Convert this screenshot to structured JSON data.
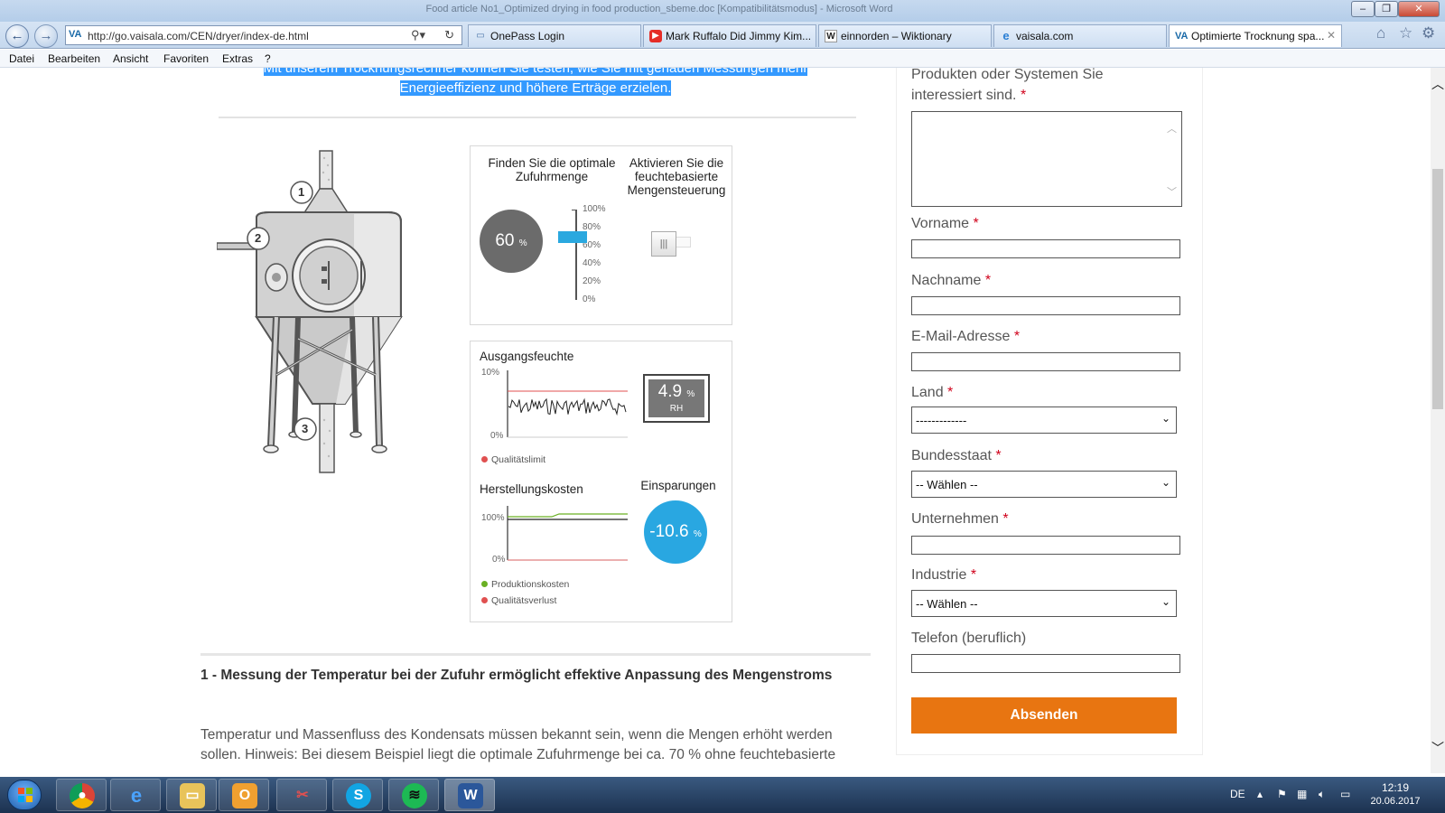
{
  "window": {
    "title": "Food article No1_Optimized drying in food production_sbeme.doc [Kompatibilitätsmodus] - Microsoft Word"
  },
  "browser": {
    "url": "http://go.vaisala.com/CEN/dryer/index-de.html",
    "tabs": [
      {
        "label": "OnePass Login",
        "icon": "onepass-icon"
      },
      {
        "label": "Mark Ruffalo Did Jimmy Kim...",
        "icon": "youtube-icon"
      },
      {
        "label": "einnorden – Wiktionary",
        "icon": "wiktionary-icon"
      },
      {
        "label": "vaisala.com",
        "icon": "ie-icon"
      },
      {
        "label": "Optimierte Trocknung spa...",
        "icon": "vaisala-icon"
      }
    ],
    "menu": [
      "Datei",
      "Bearbeiten",
      "Ansicht",
      "Favoriten",
      "Extras",
      "?"
    ]
  },
  "page": {
    "intro_line1": "Mit unserem Trocknungsrechner können Sie testen, wie Sie mit genauen Messungen mehr",
    "intro_line2": "Energieeffizienz und höhere Erträge erzielen.",
    "diagram_labels": [
      "1",
      "2",
      "3"
    ],
    "panel1": {
      "feed_title": "Finden Sie die optimale Zufuhrmenge",
      "feed_value": "60",
      "feed_unit": "%",
      "feed_slider_level_pct": 70,
      "toggle_title": "Aktivieren Sie die feuchtebasierte Mengensteuerung",
      "toggle_symbol": "|||",
      "slider_ticks": [
        "100%",
        "80%",
        "60%",
        "40%",
        "20%",
        "0%"
      ]
    },
    "panel2": {
      "humidity_title": "Ausgangsfeuchte",
      "humidity_ticks": [
        "10%",
        "0%"
      ],
      "rh_value": "4.9",
      "rh_unit": "%",
      "rh_label": "RH",
      "legend_quality_limit": "Qualitätslimit",
      "cost_title": "Herstellungskosten",
      "cost_ticks": [
        "100%",
        "0%"
      ],
      "savings_title": "Einsparungen",
      "savings_value": "-10.6",
      "savings_unit": "%",
      "legend_production_cost": "Produktionskosten",
      "legend_quality_loss": "Qualitätsverlust"
    },
    "section_heading": "1 - Messung der Temperatur bei der Zufuhr ermöglicht effektive Anpassung des Mengenstroms",
    "section_body": "Temperatur und Massenfluss des Kondensats müssen bekannt sein, wenn die Mengen erhöht werden sollen. Hinweis: Bei diesem Beispiel liegt die optimale Zufuhrmenge bei ca. 70 % ohne feuchtebasierte"
  },
  "form": {
    "interest_label": "Produkten oder Systemen Sie interessiert sind.",
    "required_marker": "*",
    "first_name_label": "Vorname",
    "last_name_label": "Nachname",
    "email_label": "E-Mail-Adresse",
    "country_label": "Land",
    "country_value": "-------------",
    "state_label": "Bundesstaat",
    "state_value": "-- Wählen --",
    "company_label": "Unternehmen",
    "industry_label": "Industrie",
    "industry_value": "-- Wählen --",
    "phone_label": "Telefon (beruflich)",
    "submit_label": "Absenden"
  },
  "taskbar": {
    "apps": [
      "chrome-icon",
      "internet-explorer-icon",
      "explorer-icon",
      "outlook-icon",
      "snipping-tool-icon",
      "skype-icon",
      "spotify-icon",
      "word-icon"
    ],
    "language": "DE",
    "time": "12:19",
    "date": "20.06.2017"
  },
  "colors": {
    "highlight": "#3399ff",
    "slider_blue": "#2aa8df",
    "savings_blue": "#29a7e1",
    "submit_orange": "#e87511",
    "required_red": "#d0021b",
    "quality_red": "#e05050",
    "production_green": "#6ab023"
  }
}
